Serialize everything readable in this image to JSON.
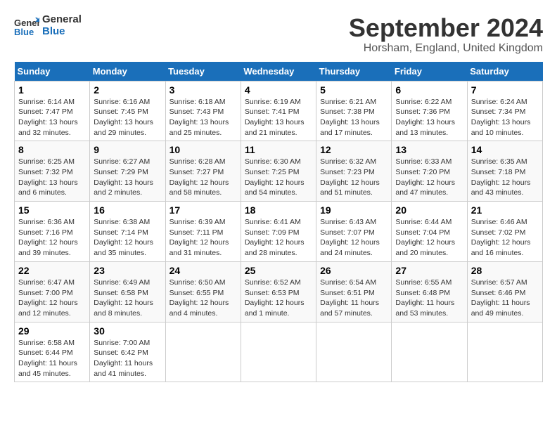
{
  "header": {
    "logo_general": "General",
    "logo_blue": "Blue",
    "month": "September 2024",
    "location": "Horsham, England, United Kingdom"
  },
  "days_of_week": [
    "Sunday",
    "Monday",
    "Tuesday",
    "Wednesday",
    "Thursday",
    "Friday",
    "Saturday"
  ],
  "weeks": [
    [
      {
        "day": "1",
        "info": "Sunrise: 6:14 AM\nSunset: 7:47 PM\nDaylight: 13 hours\nand 32 minutes."
      },
      {
        "day": "2",
        "info": "Sunrise: 6:16 AM\nSunset: 7:45 PM\nDaylight: 13 hours\nand 29 minutes."
      },
      {
        "day": "3",
        "info": "Sunrise: 6:18 AM\nSunset: 7:43 PM\nDaylight: 13 hours\nand 25 minutes."
      },
      {
        "day": "4",
        "info": "Sunrise: 6:19 AM\nSunset: 7:41 PM\nDaylight: 13 hours\nand 21 minutes."
      },
      {
        "day": "5",
        "info": "Sunrise: 6:21 AM\nSunset: 7:38 PM\nDaylight: 13 hours\nand 17 minutes."
      },
      {
        "day": "6",
        "info": "Sunrise: 6:22 AM\nSunset: 7:36 PM\nDaylight: 13 hours\nand 13 minutes."
      },
      {
        "day": "7",
        "info": "Sunrise: 6:24 AM\nSunset: 7:34 PM\nDaylight: 13 hours\nand 10 minutes."
      }
    ],
    [
      {
        "day": "8",
        "info": "Sunrise: 6:25 AM\nSunset: 7:32 PM\nDaylight: 13 hours\nand 6 minutes."
      },
      {
        "day": "9",
        "info": "Sunrise: 6:27 AM\nSunset: 7:29 PM\nDaylight: 13 hours\nand 2 minutes."
      },
      {
        "day": "10",
        "info": "Sunrise: 6:28 AM\nSunset: 7:27 PM\nDaylight: 12 hours\nand 58 minutes."
      },
      {
        "day": "11",
        "info": "Sunrise: 6:30 AM\nSunset: 7:25 PM\nDaylight: 12 hours\nand 54 minutes."
      },
      {
        "day": "12",
        "info": "Sunrise: 6:32 AM\nSunset: 7:23 PM\nDaylight: 12 hours\nand 51 minutes."
      },
      {
        "day": "13",
        "info": "Sunrise: 6:33 AM\nSunset: 7:20 PM\nDaylight: 12 hours\nand 47 minutes."
      },
      {
        "day": "14",
        "info": "Sunrise: 6:35 AM\nSunset: 7:18 PM\nDaylight: 12 hours\nand 43 minutes."
      }
    ],
    [
      {
        "day": "15",
        "info": "Sunrise: 6:36 AM\nSunset: 7:16 PM\nDaylight: 12 hours\nand 39 minutes."
      },
      {
        "day": "16",
        "info": "Sunrise: 6:38 AM\nSunset: 7:14 PM\nDaylight: 12 hours\nand 35 minutes."
      },
      {
        "day": "17",
        "info": "Sunrise: 6:39 AM\nSunset: 7:11 PM\nDaylight: 12 hours\nand 31 minutes."
      },
      {
        "day": "18",
        "info": "Sunrise: 6:41 AM\nSunset: 7:09 PM\nDaylight: 12 hours\nand 28 minutes."
      },
      {
        "day": "19",
        "info": "Sunrise: 6:43 AM\nSunset: 7:07 PM\nDaylight: 12 hours\nand 24 minutes."
      },
      {
        "day": "20",
        "info": "Sunrise: 6:44 AM\nSunset: 7:04 PM\nDaylight: 12 hours\nand 20 minutes."
      },
      {
        "day": "21",
        "info": "Sunrise: 6:46 AM\nSunset: 7:02 PM\nDaylight: 12 hours\nand 16 minutes."
      }
    ],
    [
      {
        "day": "22",
        "info": "Sunrise: 6:47 AM\nSunset: 7:00 PM\nDaylight: 12 hours\nand 12 minutes."
      },
      {
        "day": "23",
        "info": "Sunrise: 6:49 AM\nSunset: 6:58 PM\nDaylight: 12 hours\nand 8 minutes."
      },
      {
        "day": "24",
        "info": "Sunrise: 6:50 AM\nSunset: 6:55 PM\nDaylight: 12 hours\nand 4 minutes."
      },
      {
        "day": "25",
        "info": "Sunrise: 6:52 AM\nSunset: 6:53 PM\nDaylight: 12 hours\nand 1 minute."
      },
      {
        "day": "26",
        "info": "Sunrise: 6:54 AM\nSunset: 6:51 PM\nDaylight: 11 hours\nand 57 minutes."
      },
      {
        "day": "27",
        "info": "Sunrise: 6:55 AM\nSunset: 6:48 PM\nDaylight: 11 hours\nand 53 minutes."
      },
      {
        "day": "28",
        "info": "Sunrise: 6:57 AM\nSunset: 6:46 PM\nDaylight: 11 hours\nand 49 minutes."
      }
    ],
    [
      {
        "day": "29",
        "info": "Sunrise: 6:58 AM\nSunset: 6:44 PM\nDaylight: 11 hours\nand 45 minutes."
      },
      {
        "day": "30",
        "info": "Sunrise: 7:00 AM\nSunset: 6:42 PM\nDaylight: 11 hours\nand 41 minutes."
      },
      {
        "day": "",
        "info": ""
      },
      {
        "day": "",
        "info": ""
      },
      {
        "day": "",
        "info": ""
      },
      {
        "day": "",
        "info": ""
      },
      {
        "day": "",
        "info": ""
      }
    ]
  ]
}
